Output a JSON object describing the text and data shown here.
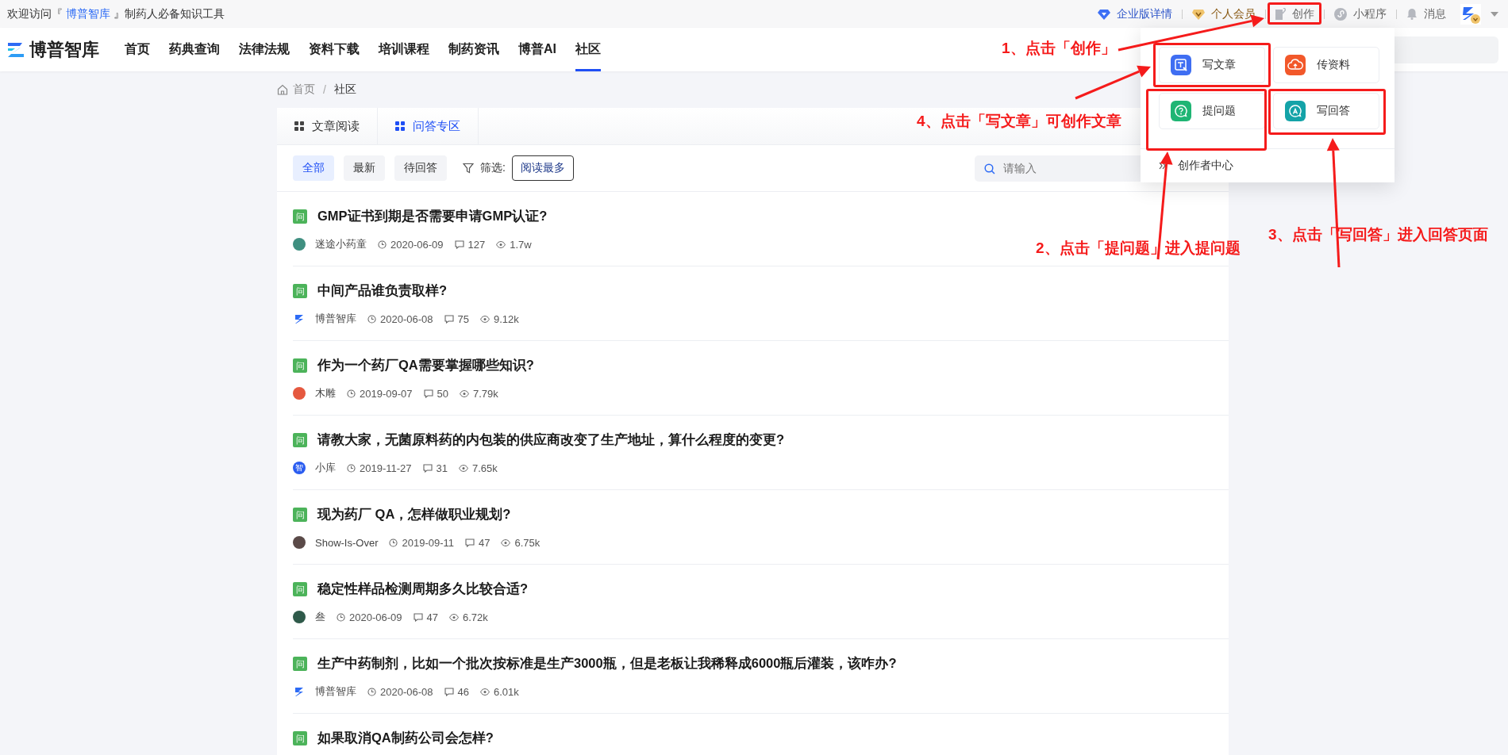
{
  "top_bar": {
    "welcome_prefix": "欢迎访问『 ",
    "site_link": "博普智库",
    "welcome_suffix": " 』制药人必备知识工具",
    "links": [
      {
        "kind": "enterprise",
        "label": "企业版详情"
      },
      {
        "kind": "member",
        "label": "个人会员"
      },
      {
        "kind": "create",
        "label": "创作"
      },
      {
        "kind": "miniapp",
        "label": "小程序"
      },
      {
        "kind": "message",
        "label": "消息"
      }
    ]
  },
  "nav": {
    "logo": "博普智库",
    "items": [
      {
        "label": "首页",
        "selected": false
      },
      {
        "label": "药典查询",
        "selected": false
      },
      {
        "label": "法律法规",
        "selected": false
      },
      {
        "label": "资料下载",
        "selected": false
      },
      {
        "label": "培训课程",
        "selected": false
      },
      {
        "label": "制药资讯",
        "selected": false
      },
      {
        "label": "博普AI",
        "selected": false
      },
      {
        "label": "社区",
        "selected": true
      }
    ]
  },
  "breadcrumb": {
    "items": [
      "首页",
      "社区"
    ],
    "separator": "/"
  },
  "tabs": [
    {
      "label": "文章阅读",
      "selected": false
    },
    {
      "label": "问答专区",
      "selected": true
    }
  ],
  "filters": [
    {
      "label": "全部",
      "selected": true
    },
    {
      "label": "最新",
      "selected": false
    },
    {
      "label": "待回答",
      "selected": false
    }
  ],
  "filter_label": "筛选:",
  "sort": "阅读最多",
  "search": {
    "placeholder": "请输入"
  },
  "questions": [
    {
      "badge": "问",
      "title": "GMP证书到期是否需要申请GMP认证?",
      "avatar": {
        "kind": "photo",
        "color": "#3f8f80"
      },
      "author": "迷途小药童",
      "date": "2020-06-09",
      "comments": "127",
      "views": "1.7w"
    },
    {
      "badge": "问",
      "title": "中间产品谁负责取样?",
      "avatar": {
        "kind": "logo"
      },
      "author": "博普智库",
      "date": "2020-06-08",
      "comments": "75",
      "views": "9.12k"
    },
    {
      "badge": "问",
      "title": "作为一个药厂QA需要掌握哪些知识?",
      "avatar": {
        "kind": "photo",
        "color": "#e5583f"
      },
      "author": "木雕",
      "date": "2019-09-07",
      "comments": "50",
      "views": "7.79k"
    },
    {
      "badge": "问",
      "title": "请教大家，无菌原料药的内包装的供应商改变了生产地址，算什么程度的变更?",
      "avatar": {
        "kind": "initial",
        "text": "智",
        "color": "#2a5cf0"
      },
      "author": "小库",
      "date": "2019-11-27",
      "comments": "31",
      "views": "7.65k"
    },
    {
      "badge": "问",
      "title": "现为药厂 QA，怎样做职业规划?",
      "avatar": {
        "kind": "photo",
        "color": "#5a4a48"
      },
      "author": "Show-Is-Over",
      "date": "2019-09-11",
      "comments": "47",
      "views": "6.75k"
    },
    {
      "badge": "问",
      "title": "稳定性样品检测周期多久比较合适?",
      "avatar": {
        "kind": "photo",
        "color": "#2f5a4a"
      },
      "author": "叁",
      "date": "2020-06-09",
      "comments": "47",
      "views": "6.72k"
    },
    {
      "badge": "问",
      "title": "生产中药制剂，比如一个批次按标准是生产3000瓶，但是老板让我稀释成6000瓶后灌装，该咋办?",
      "avatar": {
        "kind": "logo"
      },
      "author": "博普智库",
      "date": "2020-06-08",
      "comments": "46",
      "views": "6.01k"
    },
    {
      "badge": "问",
      "title": "如果取消QA制药公司会怎样?"
    }
  ],
  "create_menu": {
    "items": [
      {
        "kind": "article",
        "label": "写文章"
      },
      {
        "kind": "upload",
        "label": "传资料"
      },
      {
        "kind": "question",
        "label": "提问题"
      },
      {
        "kind": "answer",
        "label": "写回答"
      }
    ],
    "footer": "创作者中心"
  },
  "annotations": {
    "labels": [
      "1、点击「创作」",
      "4、点击「写文章」可创作文章",
      "3、点击「写回答」进入回答页面",
      "2、点击「提问题」进入提问题"
    ]
  }
}
